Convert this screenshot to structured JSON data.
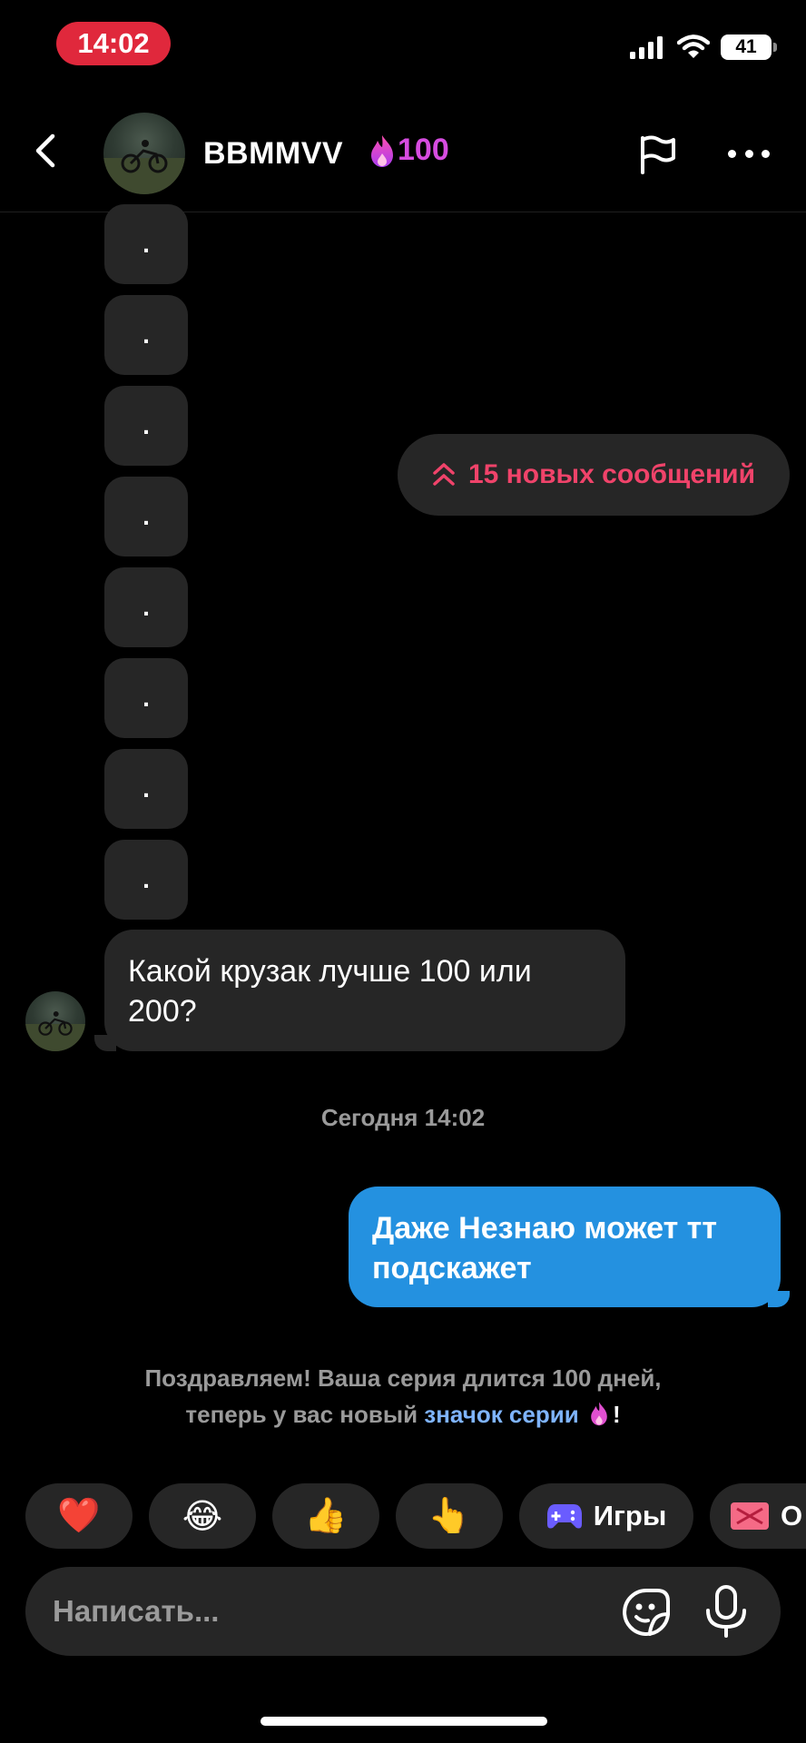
{
  "status_bar": {
    "time": "14:02",
    "battery": "41",
    "icons": [
      "cellular-signal-icon",
      "wifi-icon",
      "battery-icon"
    ]
  },
  "header": {
    "username": "BBMMVV",
    "streak_count": "100",
    "streak_icon": "fire-icon",
    "actions": [
      "back-icon",
      "flag-icon",
      "more-icon"
    ]
  },
  "chat": {
    "dot_messages": [
      ".",
      ".",
      ".",
      ".",
      ".",
      ".",
      ".",
      "."
    ],
    "new_messages_label": "15 новых сообщений",
    "incoming_message": "Какой крузак лучше 100 или 200?",
    "timestamp": "Сегодня 14:02",
    "outgoing_message": "Даже Незнаю может тт подскажет",
    "system_note": {
      "line1": "Поздравляем! Ваша серия длится 100 дней,",
      "line2_prefix": "теперь у вас новый ",
      "link": "значок серии",
      "line2_suffix": "!"
    }
  },
  "quick_reactions": {
    "emojis": [
      "❤️",
      "😂",
      "👍",
      "👆"
    ],
    "games_label": "Игры",
    "gift_label": "О"
  },
  "composer": {
    "placeholder": "Написать..."
  },
  "colors": {
    "background": "#000000",
    "bubble": "#262626",
    "outgoing": "#2491e0",
    "accent_pink": "#f0436a",
    "streak_purple": "#d64ce0",
    "time_pill": "#e0283c"
  }
}
